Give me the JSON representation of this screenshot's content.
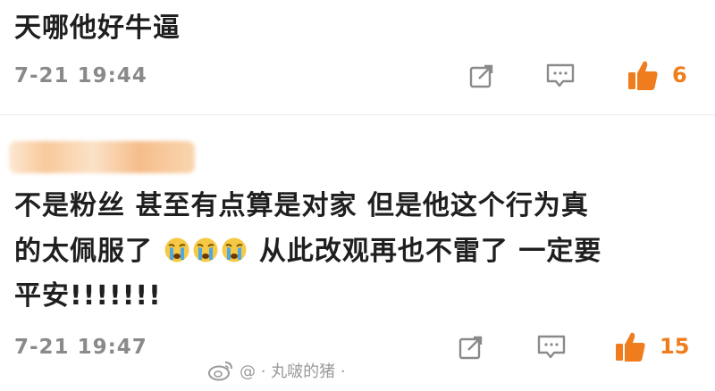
{
  "comments": [
    {
      "text": "天哪他好牛逼",
      "timestamp": "7-21 19:44",
      "likes": "6"
    },
    {
      "text_line1": "不是粉丝 甚至有点算是对家 但是他这个行为真",
      "text_line2_a": "的太佩服了",
      "text_line2_b": "从此改观再也不雷了  一定要",
      "text_line3": "平安!!!!!!!",
      "emoji": [
        "crying-face",
        "crying-face",
        "crying-face"
      ],
      "timestamp": "7-21 19:47",
      "likes": "15"
    }
  ],
  "watermark": "@ · 丸啵的猪 ·",
  "colors": {
    "like": "#f07d1d",
    "icon_gray": "#8a8a8a",
    "divider": "#ececec"
  },
  "icons": [
    "share-icon",
    "comment-icon",
    "thumbs-up-icon",
    "weibo-logo-icon",
    "crying-face-icon"
  ]
}
